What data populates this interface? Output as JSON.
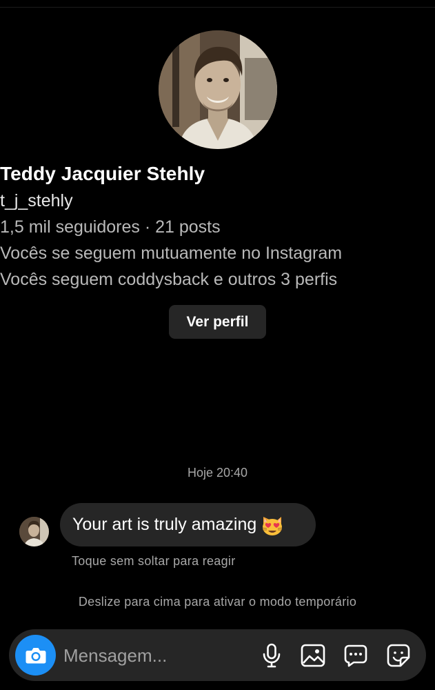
{
  "profile": {
    "name": "Teddy Jacquier Stehly",
    "username": "t_j_stehly",
    "stats": "1,5 mil seguidores · 21 posts",
    "mutual": "Vocês se seguem mutuamente no Instagram",
    "mutual_following": "Vocês seguem coddysback e outros 3 perfis",
    "view_profile_label": "Ver perfil"
  },
  "conversation": {
    "timestamp": "Hoje 20:40",
    "messages": [
      {
        "text": "Your art is truly amazing",
        "emoji": "heart-eyes-cat-emoji"
      }
    ],
    "react_hint": "Toque sem soltar para reagir",
    "vanish_hint": "Deslize para cima para ativar o modo temporário"
  },
  "composer": {
    "placeholder": "Mensagem...",
    "icons": [
      "camera-icon",
      "microphone-icon",
      "gallery-icon",
      "chat-bubble-icon",
      "sticker-icon"
    ],
    "accent_color": "#1c8ff5"
  }
}
